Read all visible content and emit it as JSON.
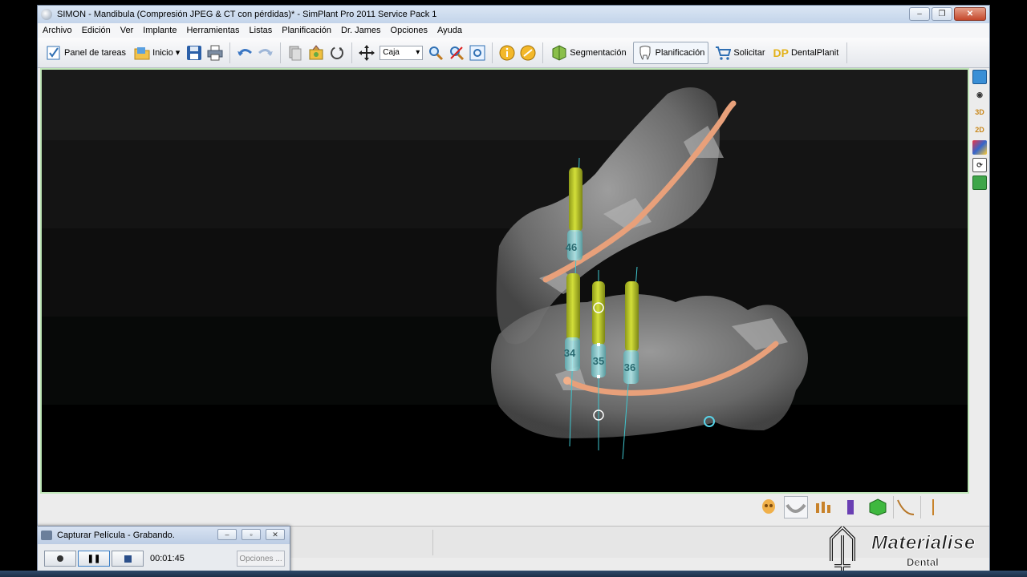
{
  "window": {
    "title": "SIMON - Mandibula (Compresión JPEG & CT con pérdidas)* - SimPlant Pro 2011 Service Pack 1",
    "minimize": "–",
    "maximize": "❐",
    "close": "✕"
  },
  "menu": [
    "Archivo",
    "Edición",
    "Ver",
    "Implante",
    "Herramientas",
    "Listas",
    "Planificación",
    "Dr. James",
    "Opciones",
    "Ayuda"
  ],
  "toolbar": {
    "panel_tareas": "Panel de tareas",
    "inicio": "Inicio",
    "mode_select": "Caja",
    "segmentacion": "Segmentación",
    "planificacion": "Planificación",
    "solicitar": "Solicitar",
    "dp_label": "DP",
    "dentalplanit": "DentalPlanit"
  },
  "side_panel": {
    "label_3d": "3D",
    "label_2d": "2D"
  },
  "implants": [
    "46",
    "34",
    "35",
    "36"
  ],
  "capture": {
    "title": "Capturar Película - Grabando.",
    "time": "00:01:45",
    "options": "Opciones ..."
  },
  "watermark": {
    "brand": "Materialise",
    "sub": "Dental"
  },
  "colors": {
    "viewport_border": "#bfe6b8",
    "implant_body": "#b8c42a",
    "abutment": "#8ed6d9",
    "nerve_canal": "#e8a07a",
    "bone": "#8a8a8a"
  }
}
